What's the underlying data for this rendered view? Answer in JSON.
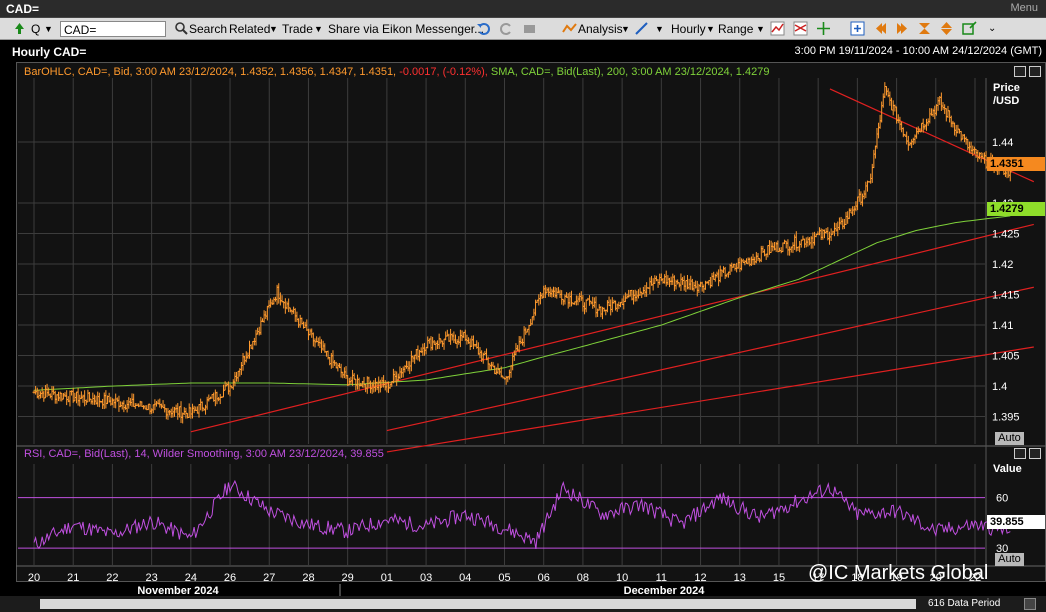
{
  "window": {
    "title": "CAD=",
    "menu_label": "Menu"
  },
  "toolbar": {
    "ric_value": "CAD=",
    "q_label": "Q",
    "search_label": "Search",
    "related_label": "Related",
    "trade_label": "Trade",
    "share_label": "Share via Eikon Messenger...",
    "analysis_label": "Analysis",
    "interval_label": "Hourly",
    "range_label": "Range"
  },
  "header": {
    "chart_title": "Hourly CAD=",
    "date_range": "3:00 PM 19/11/2024 - 10:00 AM 24/12/2024 (GMT)"
  },
  "legend": {
    "ohlc": "BarOHLC, CAD=, Bid, 3:00 AM 23/12/2024, 1.4352, 1.4356, 1.4347, 1.4351,",
    "ohlc_change": "-0.0017, (-0.12%),",
    "sma": "SMA, CAD=, Bid(Last), 200, 3:00 AM 23/12/2024, 1.4279",
    "rsi": "RSI, CAD=, Bid(Last), 14, Wilder Smoothing, 3:00 AM 23/12/2024, 39.855"
  },
  "price_axis": {
    "title_line1": "Price",
    "title_line2": "/USD",
    "last_price": "1.4351",
    "sma_value": "1.4279",
    "auto_label": "Auto"
  },
  "rsi_axis": {
    "title": "Value",
    "last_value": "39.855",
    "auto_label": "Auto"
  },
  "colors": {
    "price_bars": "#ff9a2e",
    "sma": "#7fd23a",
    "trendlines": "#e02020",
    "rsi": "#c050e0",
    "grid": "#3c3c3c"
  },
  "watermark": "@IC Markets Global",
  "status": {
    "data_period": "616 Data Period"
  },
  "chart_data": [
    {
      "type": "line",
      "title": "Hourly CAD=",
      "ylabel": "Price /USD",
      "ylim": [
        1.3905,
        1.4505
      ],
      "yticks": [
        1.395,
        1.4,
        1.405,
        1.41,
        1.415,
        1.42,
        1.425,
        1.43,
        1.44
      ],
      "x_day_ticks": [
        "20",
        "21",
        "22",
        "23",
        "24",
        "26",
        "27",
        "28",
        "29",
        "01",
        "03",
        "04",
        "05",
        "06",
        "08",
        "10",
        "11",
        "12",
        "13",
        "15",
        "17",
        "18",
        "19",
        "20",
        "22"
      ],
      "x_month_labels": [
        "November 2024",
        "December 2024"
      ],
      "grid": true,
      "x_anchor_labels": [
        "20 Nov",
        "26 Nov",
        "29 Nov",
        "03 Dec",
        "06 Dec",
        "08 Dec",
        "10 Dec",
        "12 Dec",
        "15 Dec",
        "17 Dec",
        "18 Dec",
        "20 Dec",
        "23 Dec"
      ],
      "series": [
        {
          "name": "BarOHLC, CAD=, Bid",
          "x_positions": [
            0,
            2,
            4,
            5,
            6.2,
            7,
            8,
            9,
            10,
            11,
            12,
            13,
            14.5,
            16,
            17,
            18.8,
            19.4,
            20.5,
            21.3,
            21.7,
            22.3,
            23.1,
            23.9,
            24.2,
            24.9
          ],
          "values": [
            1.399,
            1.3975,
            1.3955,
            1.4,
            1.4155,
            1.4085,
            1.401,
            1.4,
            1.407,
            1.408,
            1.401,
            1.416,
            1.4125,
            1.4175,
            1.4165,
            1.4225,
            1.4235,
            1.4255,
            1.433,
            1.4485,
            1.44,
            1.4465,
            1.4385,
            1.437,
            1.4351
          ]
        },
        {
          "name": "SMA, CAD=, Bid(Last), 200",
          "x_positions": [
            0,
            2,
            4,
            6,
            8,
            10,
            12,
            13,
            14,
            16,
            18,
            19.5,
            20.5,
            21.5,
            22.5,
            23.5,
            24.9
          ],
          "values": [
            1.3993,
            1.4,
            1.4005,
            1.4005,
            1.4002,
            1.401,
            1.403,
            1.4048,
            1.4065,
            1.41,
            1.4145,
            1.4175,
            1.4205,
            1.4235,
            1.4255,
            1.4268,
            1.4279
          ]
        }
      ],
      "trendlines": [
        {
          "x": [
            4.0,
            25.5
          ],
          "values": [
            1.3925,
            1.4265
          ]
        },
        {
          "x": [
            9.0,
            25.5
          ],
          "values": [
            1.3927,
            1.4162
          ]
        },
        {
          "x": [
            20.3,
            25.5
          ],
          "values": [
            1.4487,
            1.4335
          ]
        },
        {
          "x": [
            9.0,
            25.5
          ],
          "values": [
            1.3892,
            1.4064
          ]
        }
      ]
    },
    {
      "type": "line",
      "title": "RSI",
      "ylabel": "Value",
      "ylim": [
        20,
        80
      ],
      "yticks": [
        30,
        60
      ],
      "reference_lines": [
        30,
        60
      ],
      "series": [
        {
          "name": "RSI, CAD=, Bid(Last), 14, Wilder Smoothing",
          "x_positions": [
            0,
            1,
            2,
            3,
            4,
            5,
            6,
            7,
            8,
            9,
            10,
            11,
            12,
            12.8,
            13.5,
            14.5,
            15.5,
            16.5,
            17.5,
            18.5,
            19.5,
            20.3,
            21,
            22,
            23,
            24,
            24.9
          ],
          "values": [
            32,
            44,
            38,
            46,
            36,
            68,
            52,
            44,
            40,
            47,
            43,
            50,
            42,
            34,
            66,
            50,
            56,
            44,
            60,
            48,
            58,
            66,
            50,
            52,
            40,
            44,
            39.855
          ]
        }
      ]
    }
  ]
}
